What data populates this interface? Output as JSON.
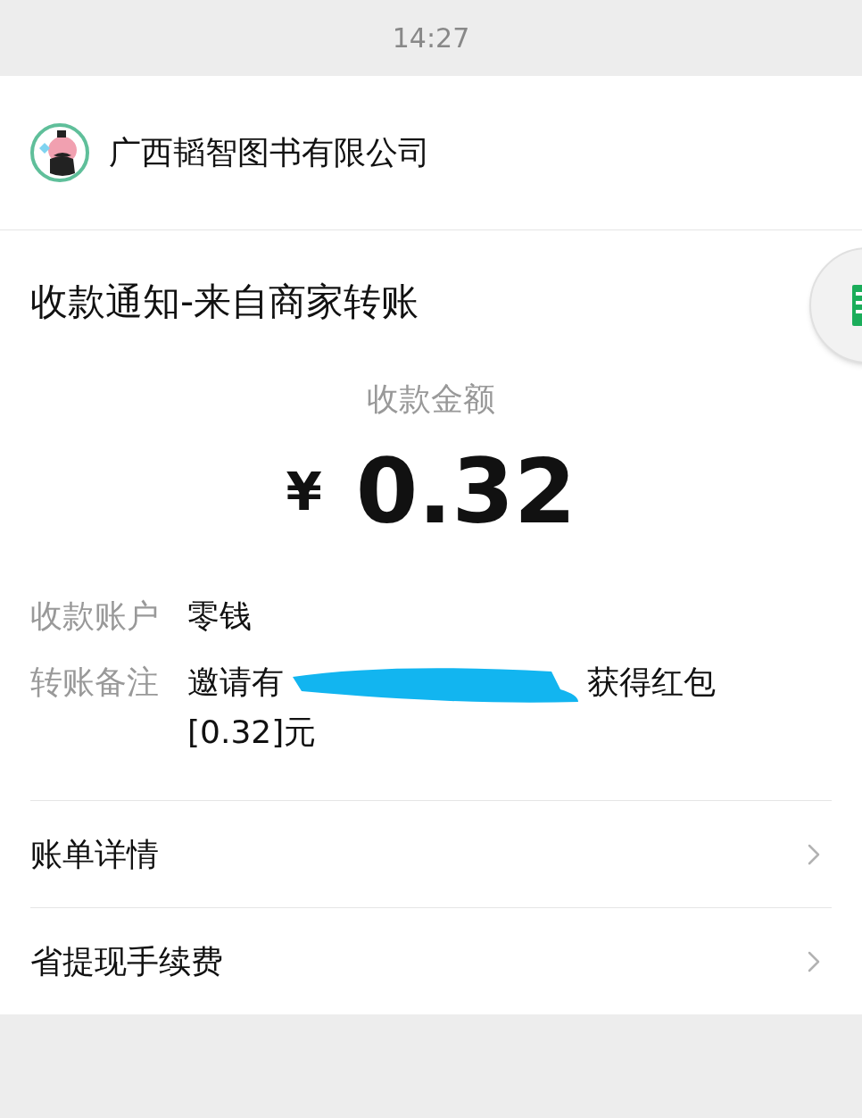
{
  "status_bar": {
    "time": "14:27"
  },
  "merchant": {
    "name": "广西韬智图书有限公司"
  },
  "notice": {
    "title": "收款通知-来自商家转账",
    "amount_label": "收款金额",
    "currency": "¥",
    "amount": "0.32",
    "fields": [
      {
        "label": "收款账户",
        "value_parts": [
          {
            "kind": "text",
            "text": "零钱"
          }
        ]
      },
      {
        "label": "转账备注",
        "value_parts": [
          {
            "kind": "text",
            "text": "邀请有"
          },
          {
            "kind": "redaction"
          },
          {
            "kind": "text",
            "text": "获得红包"
          }
        ],
        "second_line": "[0.32]元"
      }
    ]
  },
  "links": [
    {
      "label": "账单详情"
    },
    {
      "label": "省提现手续费"
    }
  ]
}
